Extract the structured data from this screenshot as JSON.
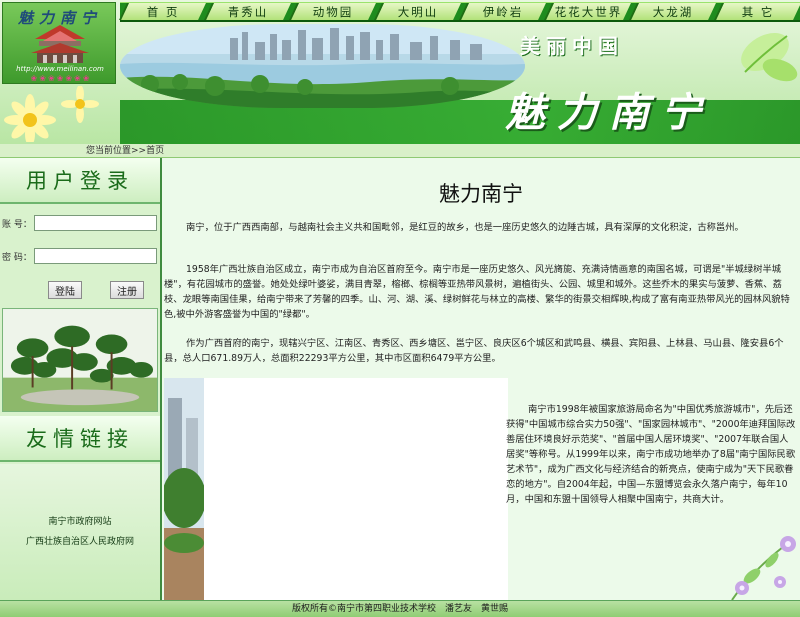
{
  "logo": {
    "title": "魅力南宁",
    "url": "http://www.meilinan.com",
    "flowers": "❀❀❀❀❀❀❀"
  },
  "nav": {
    "items": [
      {
        "label": "首 页"
      },
      {
        "label": "青秀山"
      },
      {
        "label": "动物园"
      },
      {
        "label": "大明山"
      },
      {
        "label": "伊岭岩"
      },
      {
        "label": "花花大世界"
      },
      {
        "label": "大龙湖"
      },
      {
        "label": "其 它"
      }
    ]
  },
  "banner": {
    "subtitle": "美丽中国",
    "title": "魅力南宁"
  },
  "breadcrumb": {
    "text": "您当前位置>>首页"
  },
  "sidebar": {
    "login_heading": "用户登录",
    "username_label": "账 号：",
    "password_label": "密 码：",
    "login_button": "登陆",
    "register_button": "注册",
    "links_heading": "友情链接",
    "links": [
      {
        "label": "南宁市政府网站"
      },
      {
        "label": "广西壮族自治区人民政府网"
      }
    ]
  },
  "main": {
    "title": "魅力南宁",
    "paragraphs": [
      "南宁，位于广西西南部，与越南社会主义共和国毗邻，是红豆的故乡，也是一座历史悠久的边陲古城，具有深厚的文化积淀，古称邕州。",
      "1958年广西壮族自治区成立，南宁市成为自治区首府至今。南宁市是一座历史悠久、风光旖旎、充满诗情画意的南国名城，可谓是\"半城绿树半城楼\"，有花园城市的盛誉。她处处绿叶婆娑，满目青翠，榕榔、棕榈等亚热带风景树，遍植街头、公园、城里和城外。这些乔木的果实与菠萝、香蕉、荔枝、龙眼等南国佳果，给南宁带来了芳馨的四季。山、河、湖、溪、绿树鲜花与林立的高楼、繁华的街景交相辉映,构成了富有南亚热带风光的园林风貌特色,被中外游客盛誉为中国的\"绿都\"。",
      "作为广西首府的南宁，现辖兴宁区、江南区、青秀区、西乡塘区、邕宁区、良庆区6个城区和武鸣县、横县、宾阳县、上林县、马山县、隆安县6个县，总人口671.89万人，总面积22293平方公里，其中市区面积6479平方公里。",
      "南宁市1998年被国家旅游局命名为\"中国优秀旅游城市\"，先后还获得\"中国城市综合实力50强\"、\"国家园林城市\"、\"2000年迪拜国际改善居住环境良好示范奖\"、\"首届中国人居环境奖\"、\"2007年联合国人居奖\"等称号。从1999年以来，南宁市成功地举办了8届\"南宁国际民歌艺术节\"，成为广西文化与经济结合的新亮点，使南宁成为\"天下民歌眷恋的地方\"。自2004年起，中国—东盟博览会永久落户南宁，每年10月，中国和东盟十国领导人相聚中国南宁，共商大计。"
    ]
  },
  "footer": {
    "text": "版权所有©南宁市第四职业技术学校　潘艺友　黄世赐"
  }
}
